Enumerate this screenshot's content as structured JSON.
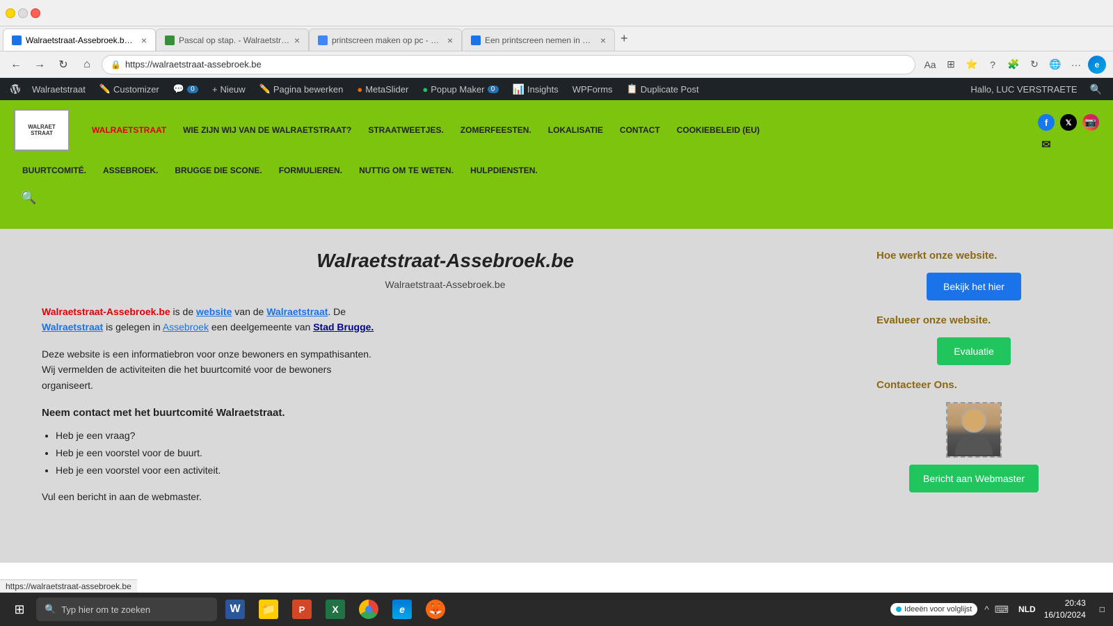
{
  "browser": {
    "tabs": [
      {
        "id": "tab1",
        "title": "Walraetstraat-Assebroek.be - Wal...",
        "url": "https://walraetstraat-assebroek.be",
        "active": true,
        "favicon_color": "#1a73e8"
      },
      {
        "id": "tab2",
        "title": "Pascal op stap. - Walraetstraat",
        "active": false,
        "favicon_color": "#388e3c"
      },
      {
        "id": "tab3",
        "title": "printscreen maken op pc - Zoeke...",
        "active": false,
        "favicon_color": "#4285f4"
      },
      {
        "id": "tab4",
        "title": "Een printscreen nemen in Windo...",
        "active": false,
        "favicon_color": "#1a73e8"
      }
    ],
    "address": "https://walraetstraat-assebroek.be"
  },
  "wp_admin_bar": {
    "items": [
      {
        "label": "Walraetstraat",
        "icon": "🏠"
      },
      {
        "label": "Customizer",
        "icon": "✏️"
      },
      {
        "label": "0",
        "icon": "💬",
        "badge": true
      },
      {
        "label": "Nieuw",
        "icon": "+"
      },
      {
        "label": "Pagina bewerken",
        "icon": "✏️"
      },
      {
        "label": "MetaSlider",
        "icon": "●"
      },
      {
        "label": "Popup Maker",
        "icon": "●",
        "badge_value": "0"
      },
      {
        "label": "Insights",
        "icon": "📊"
      },
      {
        "label": "WPForms",
        "icon": ""
      },
      {
        "label": "Duplicate Post",
        "icon": "📋"
      }
    ],
    "user": "Hallo, LUC VERSTRAETE"
  },
  "site_nav": {
    "logo_text": "WALRAETSTRAAT",
    "top_menu": [
      {
        "label": "WALRAETSTRAAT",
        "red": true
      },
      {
        "label": "WIE ZIJN WIJ VAN DE WALRAETSTRAAT?"
      },
      {
        "label": "STRAATWEETJES."
      },
      {
        "label": "ZOMERFEESTEN."
      },
      {
        "label": "LOKALISATIE"
      },
      {
        "label": "CONTACT"
      },
      {
        "label": "COOKIEBELEID (EU)"
      }
    ],
    "bottom_menu": [
      {
        "label": "BUURTCOMITÉ."
      },
      {
        "label": "ASSEBROEK."
      },
      {
        "label": "BRUGGE DIE SCONE."
      },
      {
        "label": "FORMULIEREN."
      },
      {
        "label": "NUTTIG OM TE WETEN."
      },
      {
        "label": "HULPDIENSTEN."
      }
    ],
    "social": [
      "Facebook",
      "X/Twitter",
      "Instagram"
    ]
  },
  "page": {
    "title": "Walraetstraat-Assebroek.be",
    "subtitle": "Walraetstraat-Assebroek.be",
    "intro_line1_part1": "Walraetstraat-Assebroek.be",
    "intro_line1_part2": " is de ",
    "intro_line1_part3": "website",
    "intro_line1_part4": " van de ",
    "intro_line1_part5": "Walraetstraat",
    "intro_line1_part6": ". De",
    "intro_line2_part1": "Walraetstraat",
    "intro_line2_part2": " is gelegen in ",
    "intro_line2_part3": "Assebroek",
    "intro_line2_part4": " een deelgemeente van ",
    "intro_line2_part5": "Stad Brugge.",
    "desc": "Deze website is een informatiebron voor onze bewoners en sympathisanten.\nWij vermelden de activiteiten die het buurtcomité voor de bewoners\norganiseert.",
    "contact_heading": "Neem contact met het buurtcomité Walraetstraat.",
    "bullets": [
      "Heb je een vraag?",
      "Heb je een voorstel voor de buurt.",
      "Heb je een voorstel voor een activiteit."
    ],
    "vul_text": "Vul een bericht in aan de webmaster.",
    "right": {
      "heading1": "Hoe werkt onze website.",
      "btn1_label": "Bekijk het hier",
      "heading2": "Evalueer onze website.",
      "btn2_label": "Evaluatie",
      "heading3": "Contacteer Ons.",
      "btn3_label": "Bericht aan Webmaster"
    }
  },
  "taskbar": {
    "search_placeholder": "Typ hier om te zoeken",
    "time": "20:43",
    "date": "16/10/2024",
    "language": "NLD",
    "ideas_label": "Ideeën voor volglijst",
    "url_status": "https://walraetstraat-assebroek.be"
  }
}
